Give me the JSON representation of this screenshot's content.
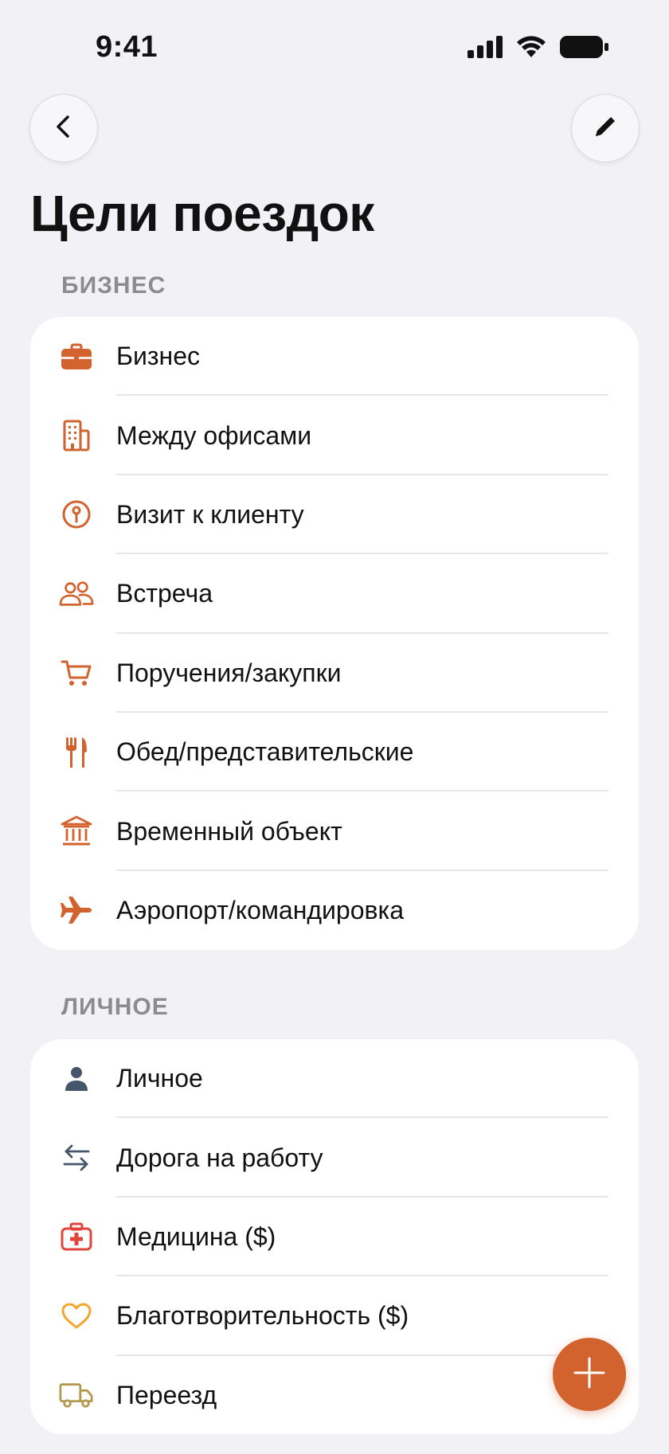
{
  "status_bar": {
    "time": "9:41",
    "icons": [
      "cellular-signal-icon",
      "wifi-icon",
      "battery-icon"
    ]
  },
  "nav": {
    "back_icon": "chevron-left-icon",
    "edit_icon": "pencil-icon"
  },
  "title": "Цели поездок",
  "colors": {
    "accent": "#D2622E",
    "personal_blue": "#45566B",
    "medical_red": "#E0443A",
    "charity_yellow": "#F2A62B",
    "moving_olive": "#B0974A",
    "background": "#F2F1F6"
  },
  "sections": {
    "business": {
      "header": "БИЗНЕС",
      "items": [
        {
          "label": "Бизнес",
          "icon": "briefcase-icon"
        },
        {
          "label": "Между офисами",
          "icon": "office-building-icon"
        },
        {
          "label": "Визит к клиенту",
          "icon": "map-pin-circle-icon"
        },
        {
          "label": "Встреча",
          "icon": "people-icon"
        },
        {
          "label": "Поручения/закупки",
          "icon": "shopping-cart-icon"
        },
        {
          "label": "Обед/представительские",
          "icon": "fork-knife-icon"
        },
        {
          "label": "Временный объект",
          "icon": "institution-building-icon"
        },
        {
          "label": "Аэропорт/командировка",
          "icon": "airplane-icon"
        }
      ]
    },
    "personal": {
      "header": "ЛИЧНОЕ",
      "items": [
        {
          "label": "Личное",
          "icon": "person-icon"
        },
        {
          "label": "Дорога на работу",
          "icon": "arrows-left-right-icon"
        },
        {
          "label": "Медицина ($)",
          "icon": "medical-kit-icon"
        },
        {
          "label": "Благотворительность ($)",
          "icon": "heart-icon"
        },
        {
          "label": "Переезд",
          "icon": "truck-icon"
        }
      ]
    }
  },
  "fab": {
    "icon": "plus-icon"
  }
}
